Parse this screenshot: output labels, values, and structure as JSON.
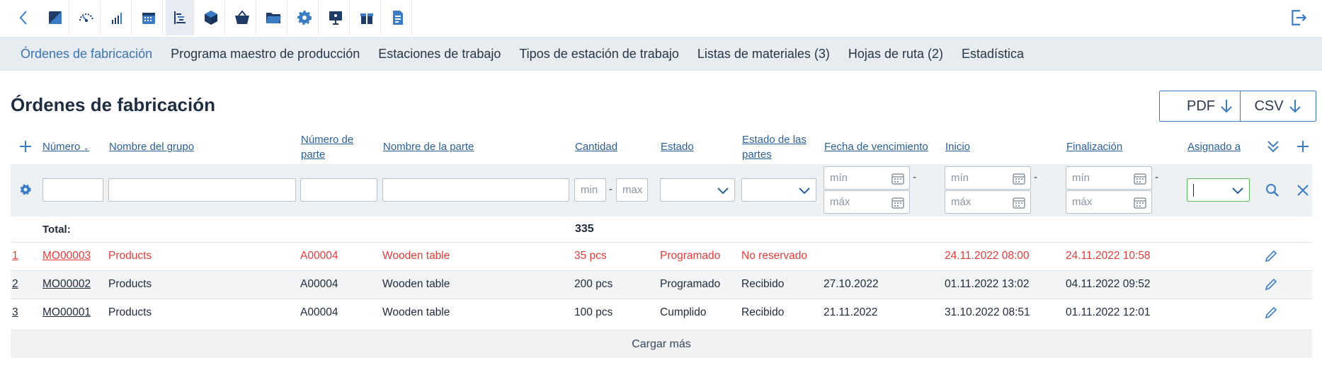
{
  "toolbar": {
    "icons": [
      "back-icon",
      "accounting-icon",
      "dashboard-gauge-icon",
      "reports-chart-icon",
      "calendar-icon",
      "production-gantt-icon",
      "inventory-box-icon",
      "purchasing-basket-icon",
      "documents-folder-icon",
      "settings-gear-icon",
      "presentation-icon",
      "gift-icon",
      "document-icon"
    ],
    "active_index": 5
  },
  "subnav": {
    "items": [
      "Órdenes de fabricación",
      "Programa maestro de producción",
      "Estaciones de trabajo",
      "Tipos de estación de trabajo",
      "Listas de materiales (3)",
      "Hojas de ruta (2)",
      "Estadística"
    ],
    "active_index": 0
  },
  "page": {
    "title": "Órdenes de fabricación",
    "pdf_label": "PDF",
    "csv_label": "CSV"
  },
  "table": {
    "headers": {
      "numero": "Número",
      "grupo": "Nombre del grupo",
      "num_parte_1": "Número de",
      "num_parte_2": "parte",
      "nombre_parte": "Nombre de la parte",
      "cantidad": "Cantidad",
      "estado": "Estado",
      "estado_partes_1": "Estado de las",
      "estado_partes_2": "partes",
      "vencimiento": "Fecha de vencimiento",
      "inicio": "Inicio",
      "finalizacion": "Finalización",
      "asignado": "Asignado a"
    },
    "filters": {
      "min": "min",
      "max": "max",
      "date_min": "mín",
      "date_max": "máx"
    },
    "total_label": "Total:",
    "total_value": "335",
    "rows": [
      {
        "idx": "1",
        "numero": "MO00003",
        "grupo": "Products",
        "num_parte": "A00004",
        "nombre_parte": "Wooden table",
        "cantidad": "35 pcs",
        "estado": "Programado",
        "estado_partes": "No reservado",
        "vencimiento": "",
        "inicio": "24.11.2022 08:00",
        "finalizacion": "24.11.2022 10:58",
        "overdue": true
      },
      {
        "idx": "2",
        "numero": "MO00002",
        "grupo": "Products",
        "num_parte": "A00004",
        "nombre_parte": "Wooden table",
        "cantidad": "200 pcs",
        "estado": "Programado",
        "estado_partes": "Recibido",
        "vencimiento": "27.10.2022",
        "inicio": "01.11.2022 13:02",
        "finalizacion": "04.11.2022 09:52",
        "overdue": false
      },
      {
        "idx": "3",
        "numero": "MO00001",
        "grupo": "Products",
        "num_parte": "A00004",
        "nombre_parte": "Wooden table",
        "cantidad": "100 pcs",
        "estado": "Cumplido",
        "estado_partes": "Recibido",
        "vencimiento": "21.11.2022",
        "inicio": "31.10.2022 08:51",
        "finalizacion": "01.11.2022 12:01",
        "overdue": false
      }
    ],
    "load_more": "Cargar más"
  },
  "colors": {
    "accent": "#3b7cc4",
    "overdue": "#e23b3b",
    "filter_bg": "#eef1f4",
    "subnav_bg": "#e7ecf1",
    "active_input_border": "#5cb85c"
  }
}
